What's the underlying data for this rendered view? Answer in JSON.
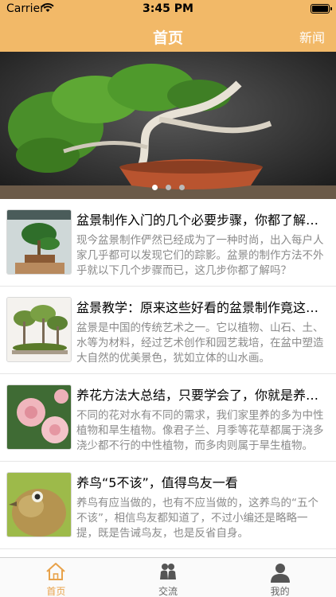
{
  "status_bar": {
    "carrier": "Carrier",
    "time": "3:45 PM"
  },
  "nav": {
    "title": "首页",
    "right_button": "新闻"
  },
  "banner": {
    "page_count": 3,
    "active_page": 1
  },
  "articles": [
    {
      "title": "盆景制作入门的几个必要步骤，你都了解吗？",
      "desc": "现今盆景制作俨然已经成为了一种时尚，出入每户人家几乎都可以发现它们的踪影。盆景的制作方法不外乎就以下几个步骤而已，这几步你都了解吗？",
      "thumb": "bonsai-pine-thumbnail"
    },
    {
      "title": "盆景教学：原来这些好看的盆景制作竟这么简单",
      "desc": "盆景是中国的传统艺术之一。它以植物、山石、土、水等为材料，经过艺术创作和园艺栽培，在盆中塑造大自然的优美景色，犹如立体的山水画。",
      "thumb": "bonsai-forest-thumbnail"
    },
    {
      "title": "养花方法大总结，只要学会了，你就是养花高手",
      "desc": "不同的花对水有不同的需求，我们家里养的多为中性植物和旱生植物。像君子兰、月季等花草都属于浇多浇少都不行的中性植物，而多肉则属于旱生植物。",
      "thumb": "pink-roses-thumbnail"
    },
    {
      "title": "养鸟“5不该”，值得鸟友一看",
      "desc": "养鸟有应当做的，也有不应当做的，这养鸟的“五个不该”，相信鸟友都知道了，不过小编还是略略一提，既是告诫鸟友，也是反省自身。",
      "thumb": "bird-thumbnail"
    }
  ],
  "tabs": [
    {
      "label": "首页",
      "icon": "home-icon",
      "active": true
    },
    {
      "label": "交流",
      "icon": "people-icon",
      "active": false
    },
    {
      "label": "我的",
      "icon": "user-icon",
      "active": false
    }
  ],
  "colors": {
    "header": "#f2b968",
    "tab_active": "#e8a24a",
    "tab_inactive": "#666666"
  }
}
